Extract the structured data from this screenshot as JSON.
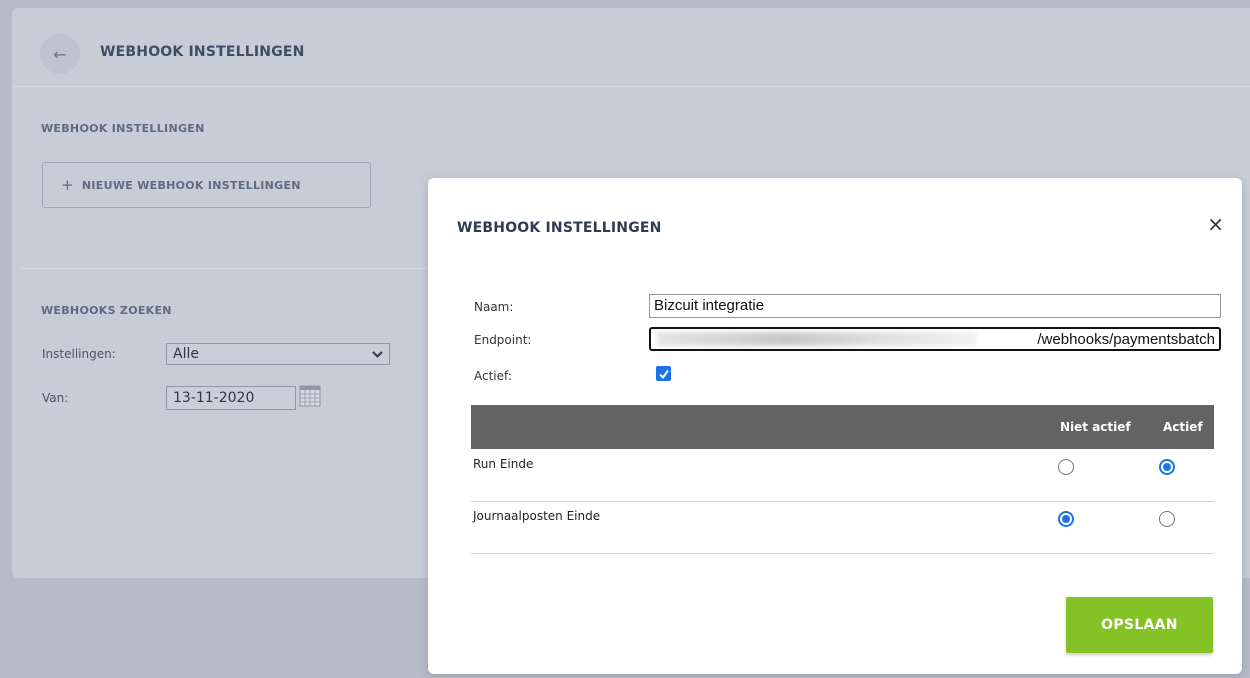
{
  "page": {
    "header_title": "WEBHOOK INSTELLINGEN",
    "back_icon": "arrow-left-icon",
    "section_settings_title": "WEBHOOK INSTELLINGEN",
    "new_button_label": "NIEUWE WEBHOOK INSTELLINGEN",
    "search_section_title": "WEBHOOKS ZOEKEN",
    "filter": {
      "settings_label": "Instellingen:",
      "settings_value": "Alle",
      "from_label": "Van:",
      "from_value": "13-11-2020"
    }
  },
  "modal": {
    "title": "WEBHOOK INSTELLINGEN",
    "close_label": "×",
    "name_label": "Naam:",
    "name_value": "Bizcuit integratie",
    "endpoint_label": "Endpoint:",
    "endpoint_value": "/webhooks/paymentsbatch",
    "active_label": "Actief:",
    "active_checked": true,
    "table": {
      "headers": [
        "",
        "Niet actief",
        "Actief"
      ],
      "rows": [
        {
          "label": "Run Einde",
          "active": true
        },
        {
          "label": "Journaalposten Einde",
          "active": false
        }
      ]
    },
    "save_label": "OPSLAAN"
  },
  "colors": {
    "accent_blue": "#1a73e8",
    "save_green": "#85c226",
    "table_header": "#636363"
  }
}
